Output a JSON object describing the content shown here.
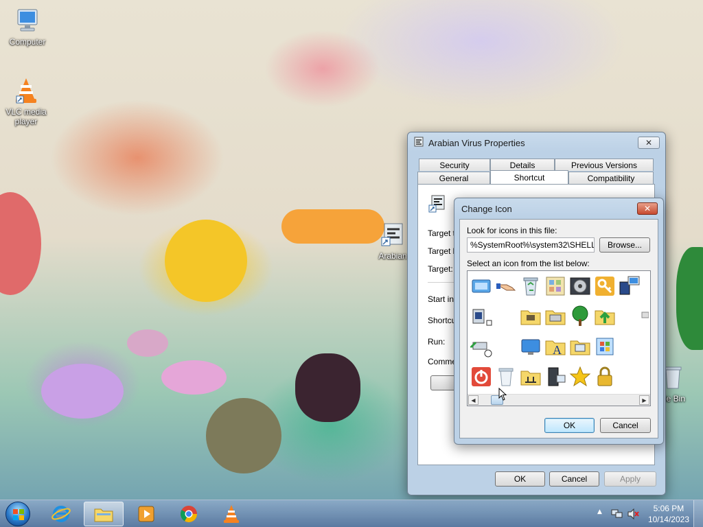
{
  "desktop": {
    "icons": [
      {
        "label": "Computer"
      },
      {
        "label": "VLC media player"
      },
      {
        "label": "Arabian"
      },
      {
        "label": "cle Bin"
      }
    ]
  },
  "properties_window": {
    "title": "Arabian Virus Properties",
    "tabs_row1": [
      "Security",
      "Details",
      "Previous Versions"
    ],
    "tabs_row2": [
      "General",
      "Shortcut",
      "Compatibility"
    ],
    "active_tab": "Shortcut",
    "fields": [
      "Target ty",
      "Target lo",
      "Target:",
      "Start in:",
      "Shortcu",
      "Run:",
      "Commen"
    ],
    "open_button": "Oper",
    "ok": "OK",
    "cancel": "Cancel",
    "apply": "Apply"
  },
  "change_icon_dialog": {
    "title": "Change Icon",
    "look_label": "Look for icons in this file:",
    "file_path": "%SystemRoot%\\system32\\SHELL32",
    "browse": "Browse...",
    "select_label": "Select an icon from the list below:",
    "ok": "OK",
    "cancel": "Cancel",
    "icon_names": [
      "display-icon",
      "hand-icon",
      "recycle-bin-full-icon",
      "control-panel-icon",
      "media-player-icon",
      "key-icon",
      "computer-network-icon",
      "drive-icon",
      "folder-tools-icon",
      "printer-drawer-icon",
      "tree-icon",
      "green-arrow-folder-icon",
      "cd-drive-icon",
      "monitor-icon",
      "font-icon",
      "folder-monitor-icon",
      "windows-window-icon",
      "power-icon",
      "recycle-bin-empty-icon",
      "network-folder-icon",
      "server-icon",
      "star-icon",
      "lock-icon"
    ]
  },
  "taskbar": {
    "pinned": [
      "internet-explorer-icon",
      "file-explorer-icon",
      "media-player-icon",
      "chrome-icon",
      "vlc-icon"
    ],
    "time": "5:06 PM",
    "date": "10/14/2023"
  }
}
